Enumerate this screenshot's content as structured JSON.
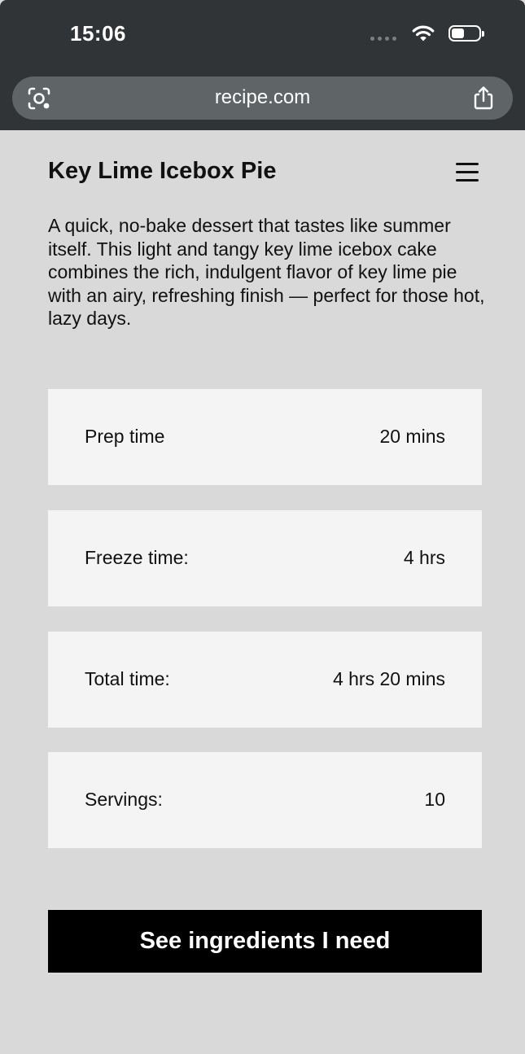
{
  "status_bar": {
    "time": "15:06",
    "icons": [
      "signal-dots-icon",
      "wifi-icon",
      "battery-icon"
    ]
  },
  "browser": {
    "url": "recipe.com",
    "left_icon": "visual-lookup-icon",
    "right_icon": "share-icon"
  },
  "recipe": {
    "title": "Key Lime Icebox Pie",
    "menu_icon": "hamburger-menu-icon",
    "description": "A quick, no-bake dessert that tastes like summer itself. This light and tangy key lime icebox cake combines the rich, indulgent flavor of key lime pie with an airy, refreshing finish — perfect for those hot, lazy days.",
    "info": [
      {
        "label": "Prep time",
        "value": "20 mins"
      },
      {
        "label": "Freeze time:",
        "value": "4 hrs"
      },
      {
        "label": "Total time:",
        "value": "4 hrs 20 mins"
      },
      {
        "label": "Servings:",
        "value": "10"
      }
    ],
    "cta_label": "See ingredients I need"
  },
  "colors": {
    "page_background": "#d9d9d9",
    "card_background": "#f4f4f4",
    "top_bar": "#303436",
    "url_bar": "#5f6467",
    "button_background": "#000000",
    "button_text": "#ffffff"
  }
}
